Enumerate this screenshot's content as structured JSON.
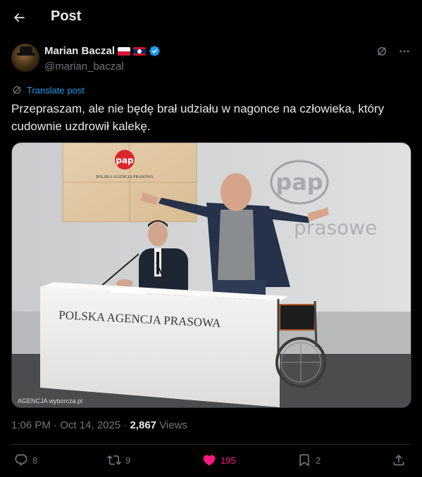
{
  "header": {
    "title": "Post"
  },
  "author": {
    "name": "Marian Baczal",
    "handle": "@marian_baczal",
    "flags": [
      "flag-poland-icon",
      "flag-laos-icon"
    ],
    "verified": true
  },
  "translate_label": "Translate post",
  "tweet_text": "Przepraszam, ale nie będę brał udziału w nagonce na człowieka, który cudownie uzdrowił kalekę.",
  "media": {
    "sign_text": "POLSKA AGENCJA PRASOWA",
    "board_logo": "pap",
    "board_small_text": "POLSKA AGENCJA PRASOWA",
    "wall_logo": "pap",
    "wall_text": "prasowe",
    "watermark": "AGENCJA wyborcza.pl"
  },
  "meta": {
    "time": "1:06 PM",
    "date": "Oct 14, 2025",
    "views_count": "2,867",
    "views_label": "Views"
  },
  "actions": {
    "replies": "8",
    "reposts": "9",
    "likes": "195",
    "bookmarks": "2"
  },
  "colors": {
    "accent": "#1d9bf0",
    "like": "#f91880",
    "muted": "#71767b",
    "text": "#e7e9ea"
  }
}
